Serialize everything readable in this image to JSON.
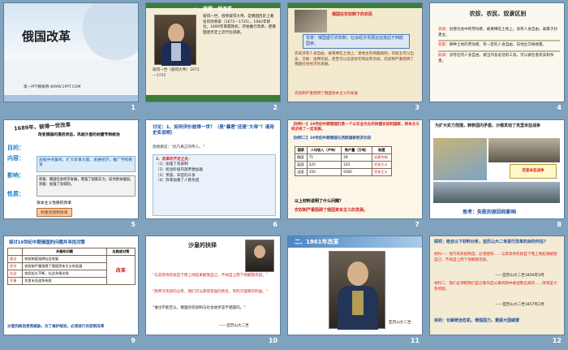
{
  "slides": [
    {
      "num": "1",
      "title": "俄国改革",
      "footer": "第一PPT模板网-WWW.1PPT.COM"
    },
    {
      "num": "2",
      "heading": "一、彼得一世改革",
      "text": "彼得一世，俗称彼得大帝，是俄国历史上著名的改革家（1672—1725）。1682年即位，1689年掌握政权，开始推行改革，使俄国逐步走上近代化道路。",
      "caption": "彼得一世（彼得大帝）1672—1725"
    },
    {
      "num": "3",
      "heading": "俄国在农奴制下的农民",
      "note": "背景：俄国盛行农奴制，社会经济发展远远落后于西欧国家。",
      "body": "农奴没有人身自由，被束缚在土地上，受地主的残酷剥削。农奴主可以出卖、交换、抵押农奴，甚至可以任意惩罚和处死农奴。农奴制严重阻碍了俄国社会经济的发展。",
      "footnote": "农奴制严重阻碍了俄国资本主义的发展"
    },
    {
      "num": "4",
      "heading": "农奴、农民、奴隶区别",
      "rows": [
        {
          "label": "农奴：",
          "text": "封建社会中的劳动者，被束缚在土地上，没有人身自由，隶属于封建主。"
        },
        {
          "label": "农民：",
          "text": "耕种土地的劳动者，有一定的人身自由，向地主交纳地租。"
        },
        {
          "label": "奴隶：",
          "text": "没有任何人身自由，被当作会说话的工具，可以被任意买卖和杀害。"
        }
      ]
    },
    {
      "num": "5",
      "heading": "1689年，彼得一世改革",
      "intro": "改变俄国的落后状态，巩固沙皇的封建专制统治",
      "labels": [
        "目的：",
        "内容：",
        "影响：",
        "性质："
      ],
      "content": "加强中央集权，扩大军事力量，发展经济，推广学校教育",
      "impact": "积极：俄国社会经济发展，增强了国家实力，成为欧洲强国。消极：加强了农奴制。",
      "nature": "资本主义性质的改革",
      "tag": "封建农奴制改革"
    },
    {
      "num": "6",
      "question": "讨论：1、如何评价彼得一世？（是\"暴君\"还是\"大帝\"？请用史实说明）",
      "quote": "恩格斯说：\"此乃真正的伟人。\"",
      "conclusion": "2、改革的不足之处：",
      "items": [
        "（1）加强了农奴制",
        "（2）统治阶级内部矛盾加剧",
        "（3）贵族、军官的斗争",
        "（4）改革加重了人民负担"
      ]
    },
    {
      "num": "7",
      "material1": "【材料一】19世纪中期俄国仍是一个以农业为主的封建农奴制国家，资本主义经济有了一定发展。",
      "material2": "【材料二】19世纪中期俄国与西欧国家经济比较",
      "headers": [
        "国家",
        "人均收入（卢布）",
        "铁产量（万吨）",
        "制度"
      ],
      "table": [
        [
          "俄国",
          "71",
          "29",
          "封建专制"
        ],
        [
          "英国",
          "225",
          "225",
          "资本主义"
        ],
        [
          "法国",
          "150",
          "9160",
          "资本主义"
        ]
      ],
      "question": "以上材料说明了什么问题？",
      "answer": "农奴制严重阻碍了俄国资本主义的发展。"
    },
    {
      "num": "8",
      "heading": "为扩大实力范围，转移国内矛盾，沙俄发动了克里米亚战争",
      "label": "克里米亚战争",
      "conclusion": "思考：失败的原因和影响"
    },
    {
      "num": "9",
      "title": "探讨19世纪中期俄国的问题并寻找对策",
      "headers": [
        "",
        "矛盾和问题",
        "出路或对策"
      ],
      "rows": [
        [
          "政治",
          "农奴制度阻碍社会发展",
          ""
        ],
        [
          "经济",
          "农奴制严重阻碍了俄国资本主义的发展",
          "改革"
        ],
        [
          "社会",
          "农民起义不断，社会矛盾尖锐",
          ""
        ],
        [
          "军事",
          "克里米亚战争失败",
          ""
        ]
      ],
      "bottom": "沙皇的统治受到威胁，为了维护统治，必须进行农奴制改革"
    },
    {
      "num": "10",
      "heading": "沙皇的抉择",
      "quote1": "\"与其等待农奴自下而上地起来解放自己，不如自上而下地解放农奴。\"",
      "quote2": "\"放弃对农奴的占有，我们可以获得有益的改良，有利于国家的利益。\"",
      "quote3": "\"谁也不能否认，俄国的农奴制与社会进步是不相容的。\"",
      "source": "——亚历山大二世"
    },
    {
      "num": "11",
      "heading": "二、1861年改革",
      "caption": "亚历山大二世"
    },
    {
      "num": "12",
      "prompt": "探究：结合以下材料分析，亚历山大二世进行改革的目的何在？",
      "m1": "材料一：现行的农奴制度，必须废除……与其等待农奴自下而上地起来解放自己，不如自上而下地解放农奴。",
      "s1": "——亚历山大二世1856年3月",
      "m2": "材料二：我们必须把我们自己看作是从暴风雨中被拯救出来的……改革是大势所趋。",
      "s2": "——亚历山大二世1857年2月",
      "goal": "目的：化解统治危机，增强国力，重振大国威望"
    }
  ],
  "colors": {
    "bg": "#7fa2bf",
    "red": "#d4201a",
    "cream": "#f3e9cf",
    "brown": "#6b4c2a",
    "blue": "#1a4fa0"
  }
}
